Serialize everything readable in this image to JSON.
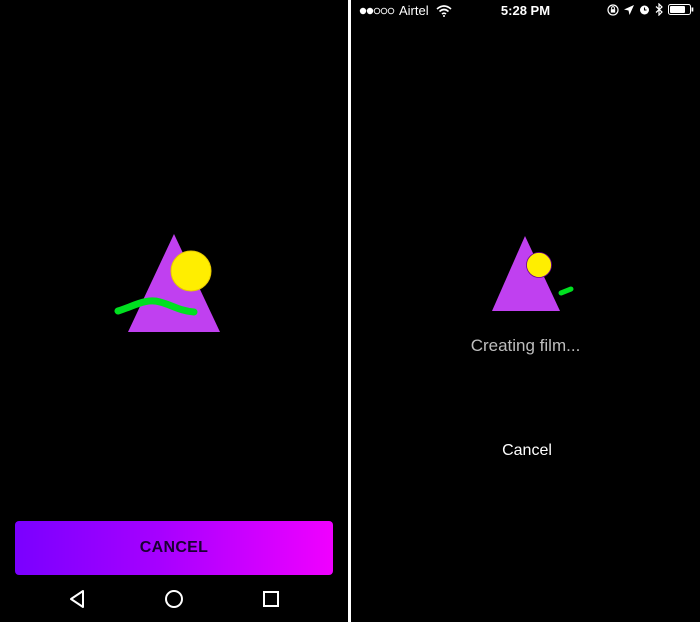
{
  "left_screen": {
    "platform": "Android",
    "cancel_button_label": "CANCEL",
    "cancel_button_gradient": [
      "#7a00ff",
      "#f000ff"
    ],
    "nav_bar": {
      "items": [
        {
          "icon": "back-triangle-icon"
        },
        {
          "icon": "home-circle-icon"
        },
        {
          "icon": "recents-square-icon"
        }
      ]
    },
    "artwork": {
      "triangle_color": "#c040f0",
      "sun_color": "#ffee00",
      "wave_color": "#00e020"
    }
  },
  "right_screen": {
    "platform": "iOS",
    "status_bar": {
      "signal_dots_filled": 2,
      "signal_dots_total": 5,
      "carrier": "Airtel",
      "time": "5:28 PM",
      "icons": [
        "wifi-icon",
        "orientation-lock-icon",
        "location-arrow-icon",
        "alarm-icon",
        "bluetooth-icon",
        "battery-icon"
      ]
    },
    "progress_text": "Creating film...",
    "cancel_label": "Cancel",
    "artwork": {
      "triangle_color": "#c040f0",
      "sun_color": "#ffee00",
      "wave_color": "#00e020"
    }
  }
}
